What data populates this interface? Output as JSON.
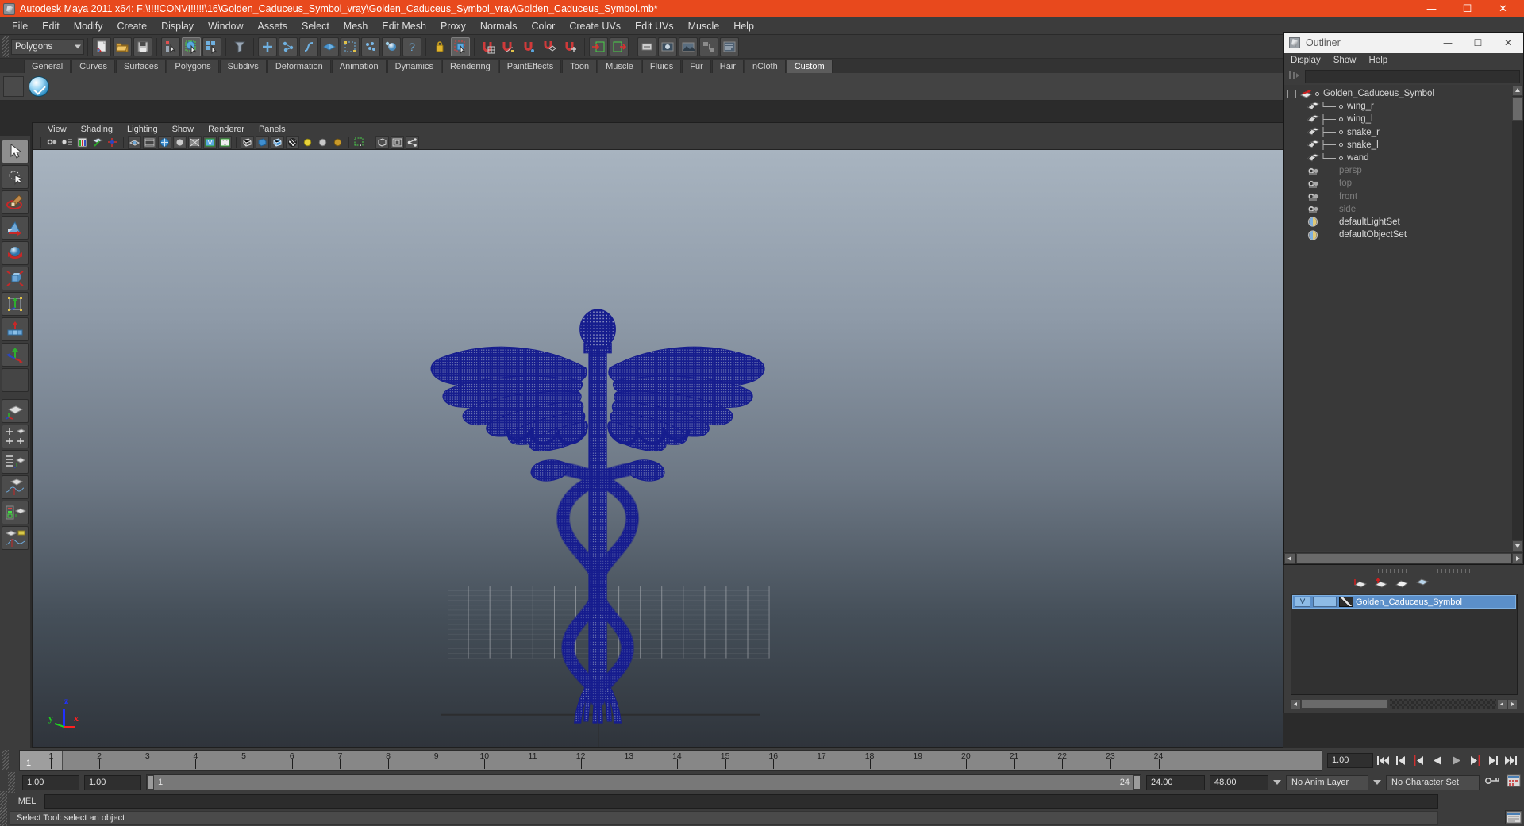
{
  "window": {
    "title": "Autodesk Maya 2011 x64: F:\\!!!!CONVI!!!!!\\16\\Golden_Caduceus_Symbol_vray\\Golden_Caduceus_Symbol_vray\\Golden_Caduceus_Symbol.mb*",
    "minimize": "—",
    "maximize": "☐",
    "close": "✕",
    "titlebar_color": "#e8491d"
  },
  "menubar": {
    "items": [
      "File",
      "Edit",
      "Modify",
      "Create",
      "Display",
      "Window",
      "Assets",
      "Select",
      "Mesh",
      "Edit Mesh",
      "Proxy",
      "Normals",
      "Color",
      "Create UVs",
      "Edit UVs",
      "Muscle",
      "Help"
    ]
  },
  "statusline": {
    "menuset": "Polygons"
  },
  "shelf": {
    "tabs": [
      "General",
      "Curves",
      "Surfaces",
      "Polygons",
      "Subdivs",
      "Deformation",
      "Animation",
      "Dynamics",
      "Rendering",
      "PaintEffects",
      "Toon",
      "Muscle",
      "Fluids",
      "Fur",
      "Hair",
      "nCloth",
      "Custom"
    ],
    "active_tab": "Custom"
  },
  "viewport": {
    "menus": [
      "View",
      "Shading",
      "Lighting",
      "Show",
      "Renderer",
      "Panels"
    ],
    "axes": {
      "x": "x",
      "y": "y",
      "z": "z"
    },
    "axis_colors": {
      "x": "#ff2020",
      "y": "#20d020",
      "z": "#2030ff"
    },
    "wireframe_color": "#161d8e",
    "background_top": "#a8b4c0",
    "background_bottom": "#2f343b"
  },
  "outliner": {
    "title": "Outliner",
    "minimize": "—",
    "maximize": "☐",
    "close": "✕",
    "menus": [
      "Display",
      "Show",
      "Help"
    ],
    "search_value": "",
    "items": [
      {
        "label": "Golden_Caduceus_Symbol",
        "type": "group",
        "depth": 0,
        "dim": false,
        "expanded": true
      },
      {
        "label": "wing_r",
        "type": "mesh",
        "depth": 1,
        "dim": false
      },
      {
        "label": "wing_l",
        "type": "mesh",
        "depth": 1,
        "dim": false
      },
      {
        "label": "snake_r",
        "type": "mesh",
        "depth": 1,
        "dim": false
      },
      {
        "label": "snake_l",
        "type": "mesh",
        "depth": 1,
        "dim": false
      },
      {
        "label": "wand",
        "type": "mesh",
        "depth": 1,
        "dim": false
      },
      {
        "label": "persp",
        "type": "camera",
        "depth": 0,
        "dim": true
      },
      {
        "label": "top",
        "type": "camera",
        "depth": 0,
        "dim": true
      },
      {
        "label": "front",
        "type": "camera",
        "depth": 0,
        "dim": true
      },
      {
        "label": "side",
        "type": "camera",
        "depth": 0,
        "dim": true
      },
      {
        "label": "defaultLightSet",
        "type": "set",
        "depth": 0,
        "dim": false
      },
      {
        "label": "defaultObjectSet",
        "type": "set",
        "depth": 0,
        "dim": false
      }
    ]
  },
  "layer_editor": {
    "layer": {
      "visibility": "V",
      "playback": "",
      "name": "Golden_Caduceus_Symbol",
      "color": "#5b8fc9"
    }
  },
  "timeline": {
    "ticks": [
      1,
      2,
      3,
      4,
      5,
      6,
      7,
      8,
      9,
      10,
      11,
      12,
      13,
      14,
      15,
      16,
      17,
      18,
      19,
      20,
      21,
      22,
      23,
      24
    ],
    "current_frame": "1",
    "current_time_field": "1.00",
    "range_start": "1.00",
    "range_end": "1.00",
    "range_slider_start": "1",
    "range_slider_end": "24",
    "anim_end": "24.00",
    "playback_end": "48.00",
    "anim_layer": "No Anim Layer",
    "character_set": "No Character Set"
  },
  "command_line": {
    "label": "MEL",
    "value": "",
    "placeholder": ""
  },
  "status_bar": {
    "message": "Select Tool: select an object"
  },
  "toolbox": {
    "tools": [
      {
        "name": "select-tool",
        "selected": true
      },
      {
        "name": "lasso-select-tool",
        "selected": false
      },
      {
        "name": "paint-select-tool",
        "selected": false
      },
      {
        "name": "move-tool",
        "selected": false
      },
      {
        "name": "rotate-tool",
        "selected": false
      },
      {
        "name": "scale-tool",
        "selected": false
      },
      {
        "name": "universal-manipulator-tool",
        "selected": false
      },
      {
        "name": "soft-modification-tool",
        "selected": false
      },
      {
        "name": "show-manipulator-tool",
        "selected": false
      },
      {
        "name": "last-tool-used",
        "selected": false
      }
    ],
    "layouts": [
      "single-perspective-layout",
      "four-view-layout",
      "outliner-persp-layout",
      "persp-graph-layout",
      "hypershade-persp-layout",
      "persp-graph-outliner-layout"
    ]
  }
}
